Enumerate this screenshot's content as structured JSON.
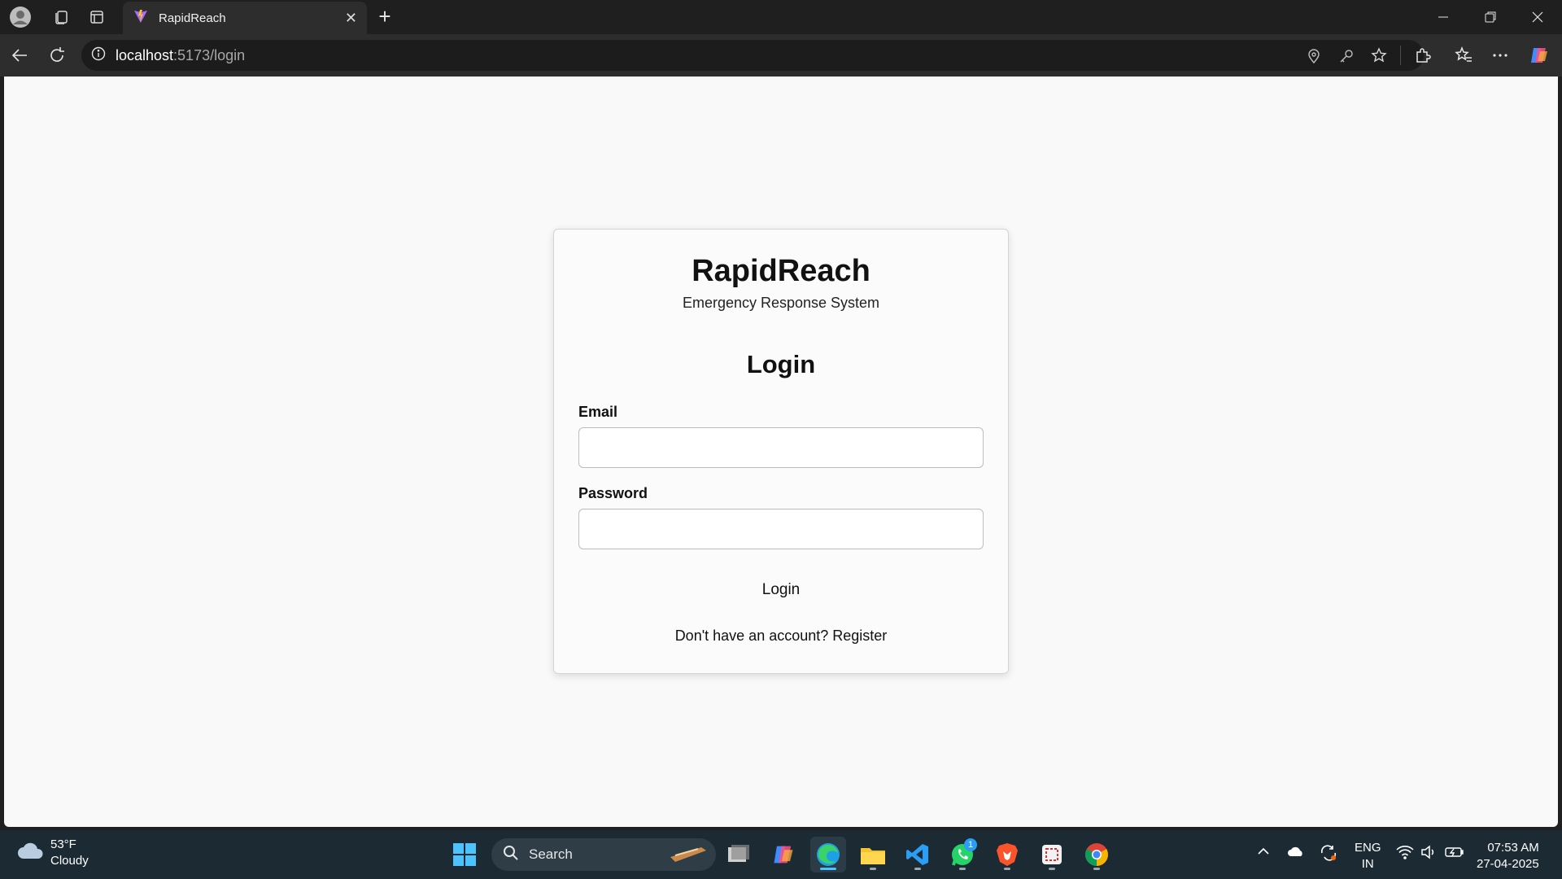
{
  "browser": {
    "tab_title": "RapidReach",
    "url_host": "localhost",
    "url_path": ":5173/login",
    "address_placeholder": ""
  },
  "page": {
    "brand": "RapidReach",
    "tagline": "Emergency Response System",
    "heading": "Login",
    "email_label": "Email",
    "email_value": "",
    "password_label": "Password",
    "password_value": "",
    "login_button": "Login",
    "register_link": "Don't have an account? Register"
  },
  "taskbar": {
    "weather_temp": "53°F",
    "weather_desc": "Cloudy",
    "search_label": "Search",
    "lang_1": "ENG",
    "lang_2": "IN",
    "time": "07:53 AM",
    "date": "27-04-2025",
    "whatsapp_badge": "1"
  },
  "colors": {
    "accent": "#4cc2ff",
    "page_bg": "#f9f9f9",
    "chrome_dark": "#1f1f1f"
  }
}
